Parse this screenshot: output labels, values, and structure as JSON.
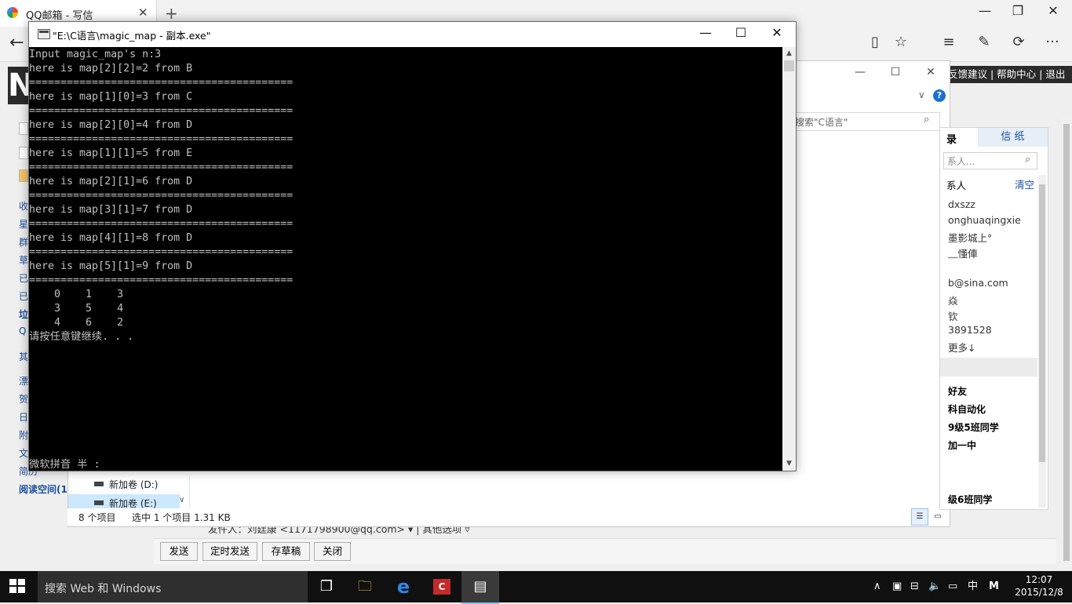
{
  "browser": {
    "tab_title": "QQ邮箱 - 写信",
    "tab_close": "✕",
    "new_tab": "+",
    "win_min": "—",
    "win_restore": "❐",
    "win_close": "✕",
    "back": "←",
    "icons": [
      "reading-view-icon",
      "favorite-star-icon",
      "hub-icon",
      "notes-icon",
      "share-icon",
      "more-icon"
    ],
    "icon_glyphs": [
      "▯",
      "☆",
      "≡",
      "✎",
      "⟳",
      "···"
    ]
  },
  "mail": {
    "logo": "N",
    "top_links": "反馈建议 | 帮助中心 | 退出",
    "left_links": [
      "收",
      "星",
      "群",
      "草",
      "已",
      "已",
      "垃",
      "Q"
    ],
    "left_links2": [
      "其",
      "漂",
      "贺",
      "日",
      "附",
      "文",
      "简历"
    ],
    "reading_space": "阅读空间(1",
    "sender": "发件人：刘廷康 <1171798900@qq.com> ▾  |  其他选项 ▿",
    "buttons": {
      "send": "发送",
      "timed": "定时发送",
      "draft": "存草稿",
      "close": "关闭"
    }
  },
  "explorer": {
    "search_placeholder": "搜索\"C语言\"",
    "help": "?",
    "chevron": "∨",
    "min": "—",
    "max": "☐",
    "close": "✕",
    "drive_d": "新加卷 (D:)",
    "drive_e": "新加卷 (E:)",
    "status_items": "8 个项目",
    "status_selected": "选中 1 个项目  1.31 KB"
  },
  "contacts": {
    "tab_active": "录",
    "tab_other": "信 纸",
    "search_placeholder": "系人...",
    "header": "系人",
    "clear": "清空",
    "items": [
      "dxszz",
      "onghuaqingxie",
      "墨影城上°",
      "﹏懂俥",
      "",
      "b@sina.com",
      "焱",
      "钦",
      "3891528",
      "更多↓"
    ],
    "groups": [
      "好友",
      "科自动化",
      "9级5班同学",
      "加一中",
      "",
      "级6班同学"
    ]
  },
  "console": {
    "title": "\"E:\\C语言\\magic_map - 副本.exe\"",
    "min": "—",
    "max": "☐",
    "close": "✕",
    "output": "Input magic_map's n:3\nhere is map[2][2]=2 from B\n==========================================\nhere is map[1][0]=3 from C\n==========================================\nhere is map[2][0]=4 from D\n==========================================\nhere is map[1][1]=5 from E\n==========================================\nhere is map[2][1]=6 from D\n==========================================\nhere is map[3][1]=7 from D\n==========================================\nhere is map[4][1]=8 from D\n==========================================\nhere is map[5][1]=9 from D\n==========================================\n    0    1    3\n    3    5    4\n    4    6    2\n请按任意键继续. . .",
    "ime": "微软拼音 半 :",
    "scroll_up": "▲",
    "scroll_down": "▼"
  },
  "taskbar": {
    "search_text": "搜索 Web 和 Windows",
    "apps": [
      "task-view-icon",
      "file-explorer-icon",
      "edge-icon",
      "cfree-icon",
      "console-app-icon"
    ],
    "app_glyphs": [
      "❐",
      "🗀",
      "e",
      "C",
      "▤"
    ],
    "tray_up": "∧",
    "tray_ime_lang": "中",
    "tray_ime_mode": "M",
    "time": "12:07",
    "date": "2015/12/8"
  }
}
